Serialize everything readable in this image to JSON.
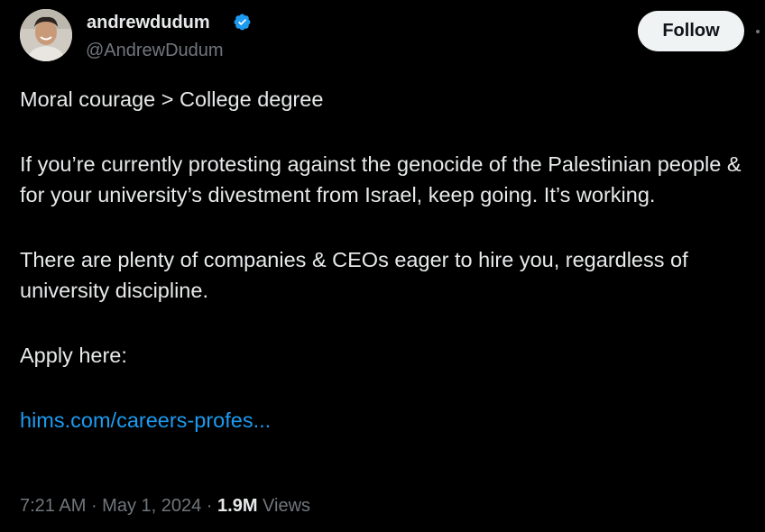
{
  "author": {
    "display_name": "andrewdudum",
    "handle": "@AndrewDudum",
    "verified_icon": "verified-badge-icon",
    "verified_color": "#1d9bf0"
  },
  "follow_button": {
    "label": "Follow"
  },
  "tweet": {
    "paragraphs": [
      "Moral courage > College degree",
      "If you’re currently protesting against the genocide of the Palestinian people & for your university’s divestment from Israel, keep going. It’s working.",
      "There are plenty of companies & CEOs eager to hire you, regardless of university discipline.",
      "Apply here:"
    ],
    "link_text": "hims.com/careers-profes...",
    "link_color": "#1d9bf0"
  },
  "meta": {
    "time": "7:21 AM",
    "separator": " · ",
    "date": "May 1, 2024",
    "views_count": "1.9M",
    "views_label": " Views"
  },
  "colors": {
    "background": "#000000",
    "text_primary": "#e7e9ea",
    "text_secondary": "#71767b",
    "button_bg": "#eff3f4"
  }
}
